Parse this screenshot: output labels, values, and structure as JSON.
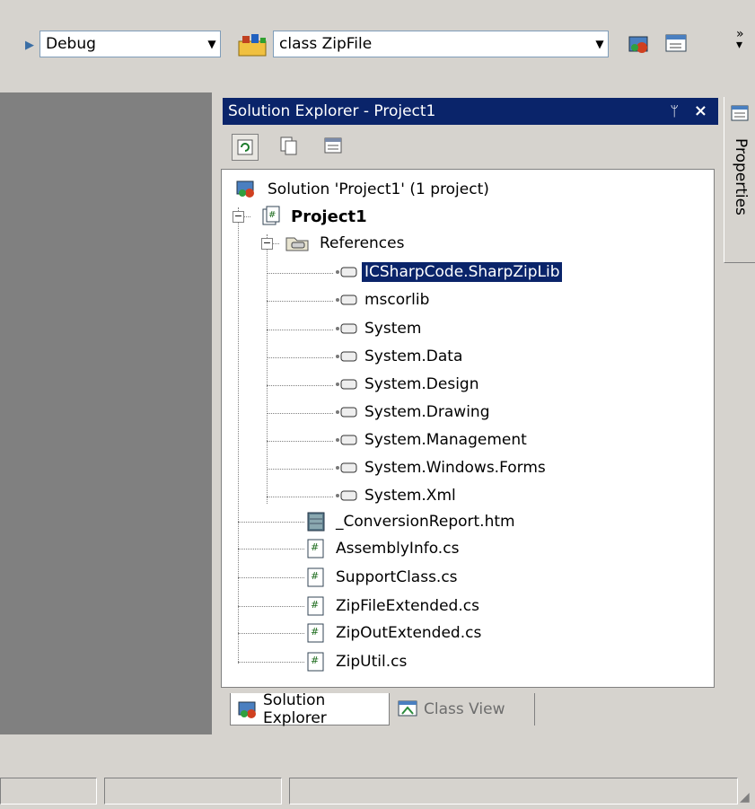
{
  "toolbar": {
    "config_value": "Debug",
    "class_value": "class ZipFile"
  },
  "solution_explorer": {
    "title": "Solution Explorer - Project1",
    "pin_glyph": " #",
    "close_glyph": "×",
    "tree": {
      "solution": "Solution 'Project1' (1 project)",
      "project": "Project1",
      "references_label": "References",
      "references": [
        "ICSharpCode.SharpZipLib",
        "mscorlib",
        "System",
        "System.Data",
        "System.Design",
        "System.Drawing",
        "System.Management",
        "System.Windows.Forms",
        "System.Xml"
      ],
      "files": [
        "_ConversionReport.htm",
        "AssemblyInfo.cs",
        "SupportClass.cs",
        "ZipFileExtended.cs",
        "ZipOutExtended.cs",
        "ZipUtil.cs"
      ]
    },
    "tabs": [
      "Solution Explorer",
      "Class View"
    ]
  },
  "properties_tab": "Properties",
  "colors": {
    "title_bar": "#0a246a",
    "selection": "#0a246a",
    "window_bg": "#d6d3ce",
    "dark_pane": "#808080"
  }
}
